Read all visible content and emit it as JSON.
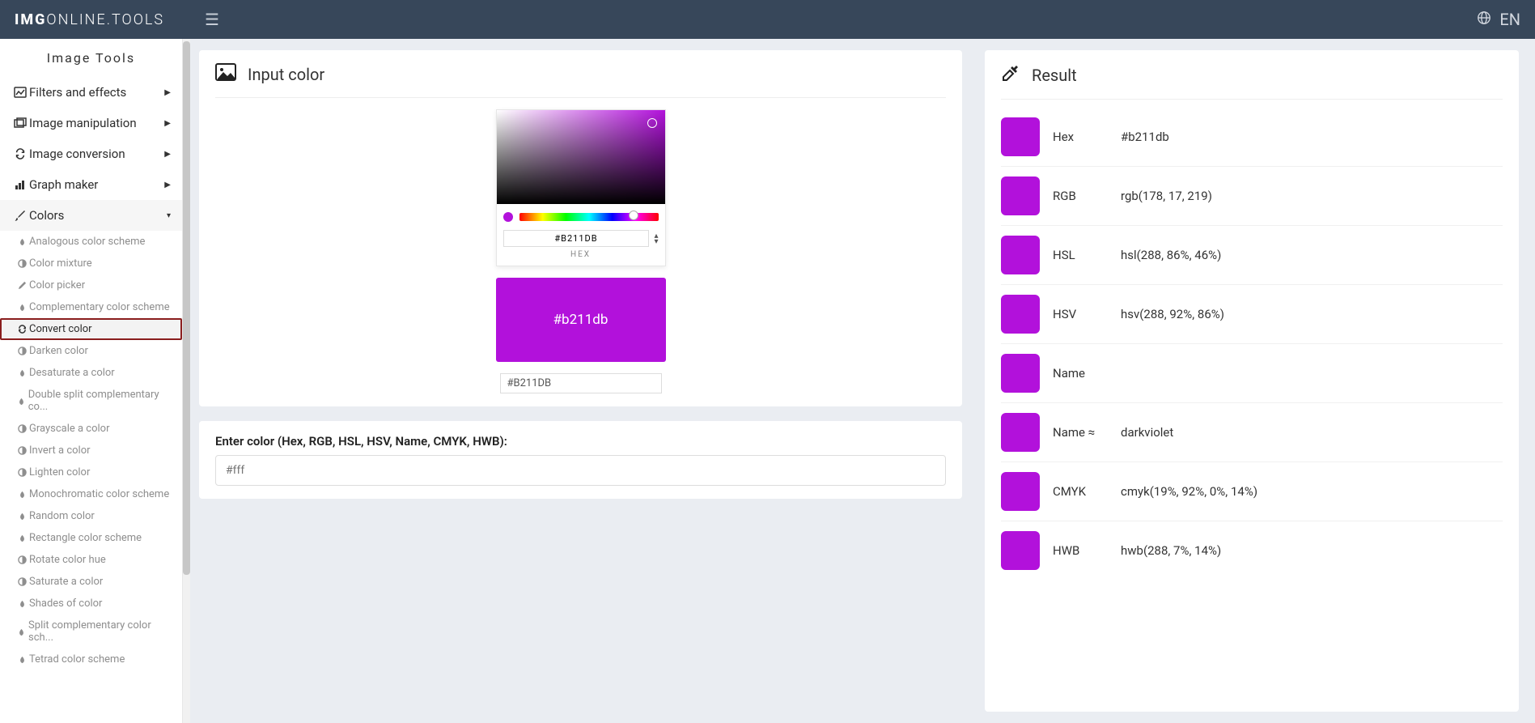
{
  "topbar": {
    "logo_bold": "IMG",
    "logo_mid": "ONLINE.",
    "logo_end": "TOOLS",
    "lang": "EN"
  },
  "sidebar": {
    "title": "Image Tools",
    "menu": [
      {
        "label": "Filters and effects",
        "icon": "▧"
      },
      {
        "label": "Image manipulation",
        "icon": "⧉"
      },
      {
        "label": "Image conversion",
        "icon": "⟳"
      },
      {
        "label": "Graph maker",
        "icon": "📊"
      },
      {
        "label": "Colors",
        "icon": "🖌"
      }
    ],
    "colors_sub": [
      {
        "label": "Analogous color scheme",
        "icon": "▲"
      },
      {
        "label": "Color mixture",
        "icon": "◐"
      },
      {
        "label": "Color picker",
        "icon": "✎"
      },
      {
        "label": "Complementary color scheme",
        "icon": "▲"
      },
      {
        "label": "Convert color",
        "icon": "⟳",
        "active": true
      },
      {
        "label": "Darken color",
        "icon": "◐"
      },
      {
        "label": "Desaturate a color",
        "icon": "▲"
      },
      {
        "label": "Double split complementary co...",
        "icon": "▲"
      },
      {
        "label": "Grayscale a color",
        "icon": "◐"
      },
      {
        "label": "Invert a color",
        "icon": "◐"
      },
      {
        "label": "Lighten color",
        "icon": "◐"
      },
      {
        "label": "Monochromatic color scheme",
        "icon": "▲"
      },
      {
        "label": "Random color",
        "icon": "▲"
      },
      {
        "label": "Rectangle color scheme",
        "icon": "▲"
      },
      {
        "label": "Rotate color hue",
        "icon": "◐"
      },
      {
        "label": "Saturate a color",
        "icon": "◐"
      },
      {
        "label": "Shades of color",
        "icon": "▲"
      },
      {
        "label": "Split complementary color sch...",
        "icon": "▲"
      },
      {
        "label": "Tetrad color scheme",
        "icon": "▲"
      }
    ]
  },
  "input_card": {
    "title": "Input color",
    "hex_value_upper": "#B211DB",
    "hex_label": "HEX",
    "swatch_text": "#b211db",
    "text_value": "#B211DB"
  },
  "enter_card": {
    "label": "Enter color (Hex, RGB, HSL, HSV, Name, CMYK, HWB):",
    "placeholder": "#fff"
  },
  "result_card": {
    "title": "Result",
    "rows": [
      {
        "label": "Hex",
        "value": "#b211db"
      },
      {
        "label": "RGB",
        "value": "rgb(178, 17, 219)"
      },
      {
        "label": "HSL",
        "value": "hsl(288, 86%, 46%)"
      },
      {
        "label": "HSV",
        "value": "hsv(288, 92%, 86%)"
      },
      {
        "label": "Name",
        "value": ""
      },
      {
        "label": "Name ≈",
        "value": "darkviolet"
      },
      {
        "label": "CMYK",
        "value": "cmyk(19%, 92%, 0%, 14%)"
      },
      {
        "label": "HWB",
        "value": "hwb(288, 7%, 14%)"
      }
    ]
  },
  "color": "#b211db"
}
